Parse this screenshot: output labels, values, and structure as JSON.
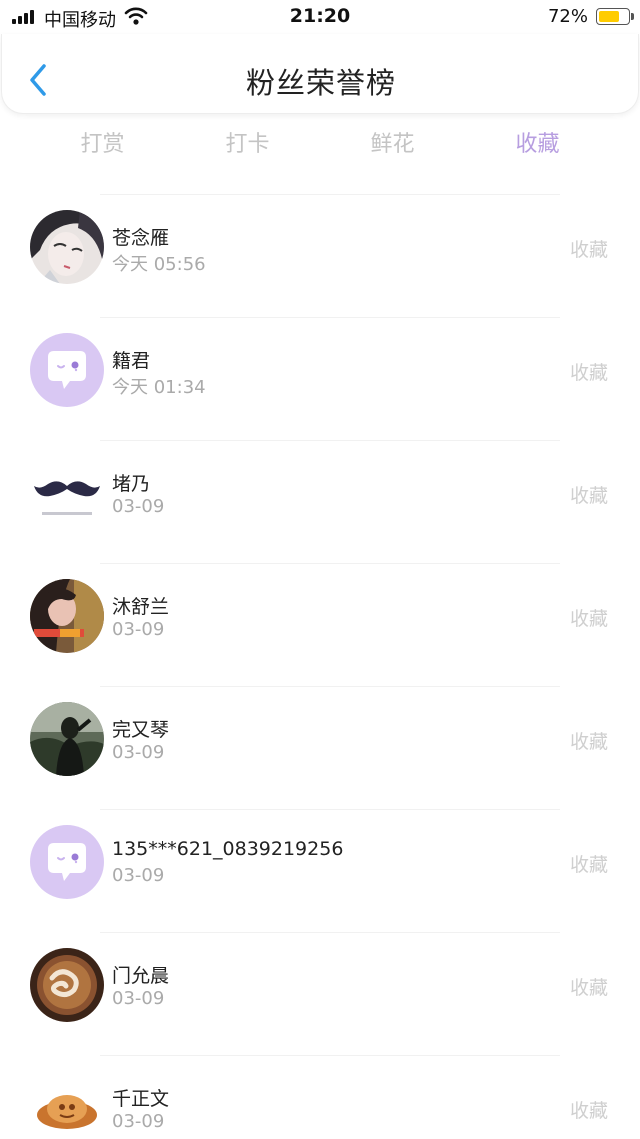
{
  "status_bar": {
    "carrier": "中国移动",
    "time": "21:20",
    "battery_percent": "72%",
    "battery_level": 0.72,
    "icons": [
      "signal-icon",
      "wifi-icon",
      "battery-icon"
    ]
  },
  "nav": {
    "title": "粉丝荣誉榜",
    "back_icon": "chevron-left-icon"
  },
  "tabs": [
    {
      "label": "打赏",
      "active": false
    },
    {
      "label": "打卡",
      "active": false
    },
    {
      "label": "鲜花",
      "active": false
    },
    {
      "label": "收藏",
      "active": true
    }
  ],
  "colors": {
    "accent": "#b79ee0",
    "placeholder_avatar": "#d9c8f3",
    "muted_text": "#aaaaaa",
    "action_text": "#cfcfcf"
  },
  "fans": [
    {
      "name": "苍念雁",
      "date": "今天 05:56",
      "action": "收藏",
      "avatar": "anime-portrait"
    },
    {
      "name": "籍君",
      "date": "今天 01:34",
      "action": "收藏",
      "avatar": "default-chat-avatar"
    },
    {
      "name": "堵乃",
      "date": "03-09",
      "action": "收藏",
      "avatar": "mustache-avatar"
    },
    {
      "name": "沐舒兰",
      "date": "03-09",
      "action": "收藏",
      "avatar": "selfie-photo"
    },
    {
      "name": "完又琴",
      "date": "03-09",
      "action": "收藏",
      "avatar": "silhouette-photo"
    },
    {
      "name": "135***621_0839219256",
      "date": "03-09",
      "action": "收藏",
      "avatar": "default-chat-avatar"
    },
    {
      "name": "门允晨",
      "date": "03-09",
      "action": "收藏",
      "avatar": "latte-art-photo"
    },
    {
      "name": "千正文",
      "date": "03-09",
      "action": "收藏",
      "avatar": "bread-photo"
    }
  ]
}
